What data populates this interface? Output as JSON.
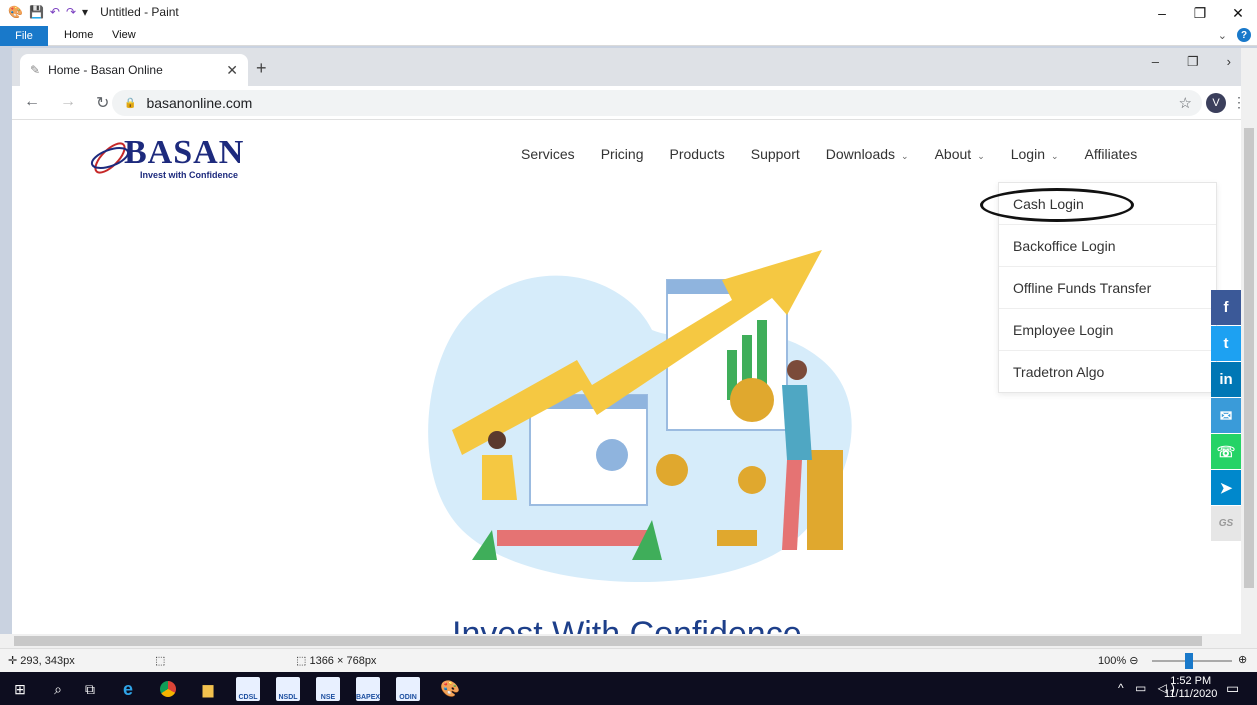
{
  "paint": {
    "window_title": "Untitled - Paint",
    "ribbon_tabs": [
      "File",
      "Home",
      "View"
    ],
    "status": {
      "cursor_position": "293, 343px",
      "image_size": "1366 × 768px",
      "zoom": "100%"
    }
  },
  "browser": {
    "tab_title": "Home - Basan Online",
    "url": "basanonline.com",
    "profile_initial": "V"
  },
  "site": {
    "logo_word": "BASAN",
    "logo_tagline": "Invest with Confidence",
    "nav": [
      {
        "label": "Services"
      },
      {
        "label": "Pricing"
      },
      {
        "label": "Products"
      },
      {
        "label": "Support"
      },
      {
        "label": "Downloads"
      },
      {
        "label": "About"
      },
      {
        "label": "Login"
      },
      {
        "label": "Affiliates"
      }
    ],
    "login_menu": [
      "Cash Login",
      "Backoffice Login",
      "Offline Funds Transfer",
      "Employee Login",
      "Tradetron Algo"
    ],
    "social": [
      {
        "label": "f",
        "color": "#3b5998",
        "icon": "facebook-icon"
      },
      {
        "label": "t",
        "color": "#1da1f2",
        "icon": "twitter-icon"
      },
      {
        "label": "in",
        "color": "#0077b5",
        "icon": "linkedin-icon"
      },
      {
        "label": "✉",
        "color": "#3a9bd9",
        "icon": "email-icon"
      },
      {
        "label": "☏",
        "color": "#25d366",
        "icon": "whatsapp-icon"
      },
      {
        "label": "➤",
        "color": "#0088cc",
        "icon": "telegram-icon"
      },
      {
        "label": "GS",
        "color": "#e6e6e6",
        "icon": "getsocial-icon"
      }
    ],
    "hero_title": "Invest With Confidence"
  },
  "taskbar": {
    "time": "1:52 PM",
    "date": "11/11/2020",
    "app_labels": [
      "CDSL",
      "NSDL",
      "NSE",
      "BAPEX",
      "ODIN"
    ]
  }
}
